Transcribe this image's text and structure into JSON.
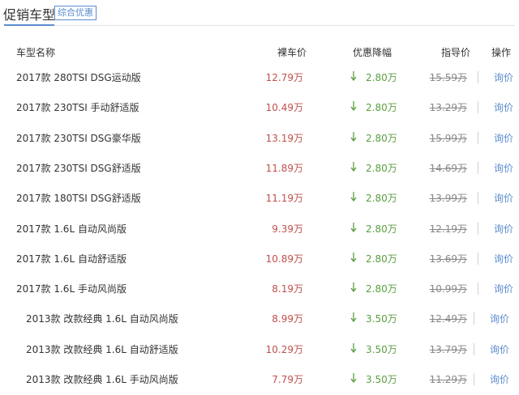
{
  "header": {
    "title": "促销车型",
    "tag": "综合优惠"
  },
  "columns": {
    "name": "车型名称",
    "price": "裸车价",
    "discount": "优惠降幅",
    "guide": "指导价",
    "operation": "操作"
  },
  "rows": [
    {
      "name": "2017款 280TSI DSG运动版",
      "price": "12.79万",
      "discount": "2.80万",
      "guide": "15.59万",
      "action": "询价"
    },
    {
      "name": "2017款 230TSI 手动舒适版",
      "price": "10.49万",
      "discount": "2.80万",
      "guide": "13.29万",
      "action": "询价"
    },
    {
      "name": "2017款 230TSI DSG豪华版",
      "price": "13.19万",
      "discount": "2.80万",
      "guide": "15.99万",
      "action": "询价"
    },
    {
      "name": "2017款 230TSI DSG舒适版",
      "price": "11.89万",
      "discount": "2.80万",
      "guide": "14.69万",
      "action": "询价"
    },
    {
      "name": "2017款 180TSI DSG舒适版",
      "price": "11.19万",
      "discount": "2.80万",
      "guide": "13.99万",
      "action": "询价"
    },
    {
      "name": "2017款 1.6L 自动风尚版",
      "price": "9.39万",
      "discount": "2.80万",
      "guide": "12.19万",
      "action": "询价"
    },
    {
      "name": "2017款 1.6L 自动舒适版",
      "price": "10.89万",
      "discount": "2.80万",
      "guide": "13.69万",
      "action": "询价"
    },
    {
      "name": "2017款 1.6L 手动风尚版",
      "price": "8.19万",
      "discount": "2.80万",
      "guide": "10.99万",
      "action": "询价"
    },
    {
      "name": "2013款 改款经典 1.6L 自动风尚版",
      "price": "8.99万",
      "discount": "3.50万",
      "guide": "12.49万",
      "action": "询价"
    },
    {
      "name": "2013款 改款经典 1.6L 自动舒适版",
      "price": "10.29万",
      "discount": "3.50万",
      "guide": "13.79万",
      "action": "询价"
    },
    {
      "name": "2013款 改款经典 1.6L 手动风尚版",
      "price": "7.79万",
      "discount": "3.50万",
      "guide": "11.29万",
      "action": "询价"
    }
  ],
  "discount_icon": "down-arrow-icon",
  "colors": {
    "accent": "#5b8ccf",
    "price": "#c0504d",
    "discount": "#5a9e40",
    "guide": "#888888"
  }
}
